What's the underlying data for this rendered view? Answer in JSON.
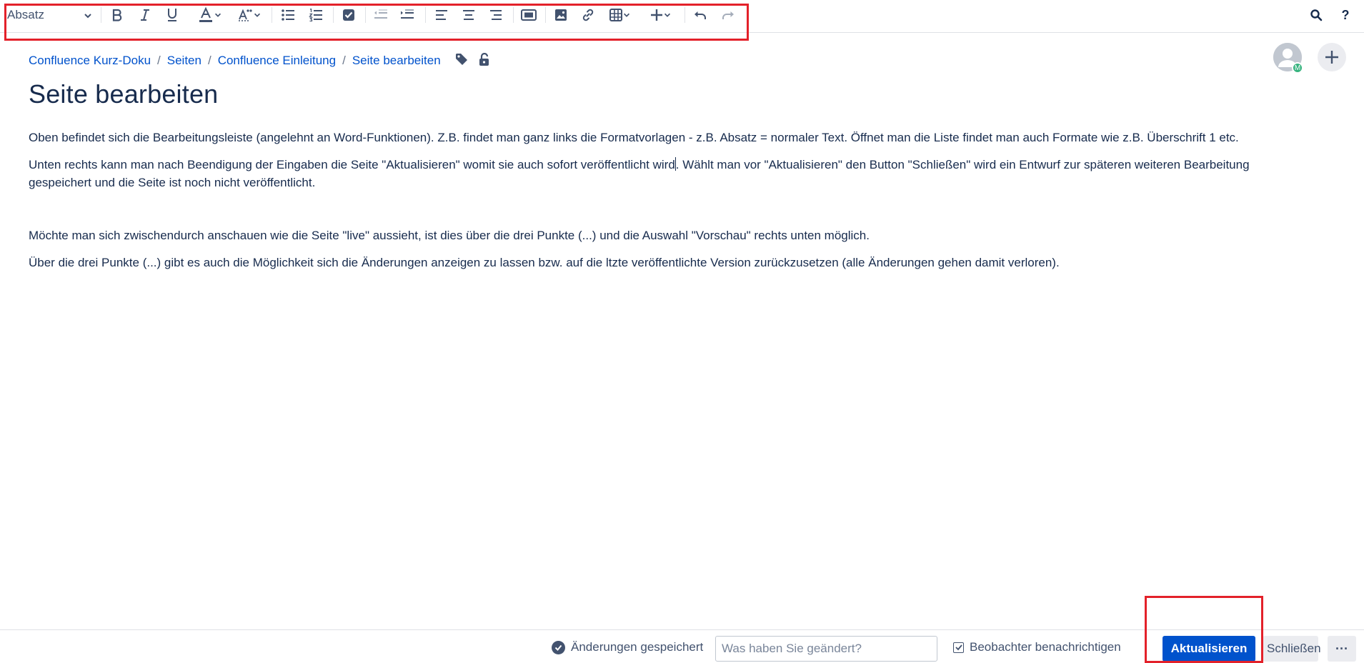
{
  "toolbar": {
    "paragraph_style": "Absatz"
  },
  "breadcrumb": [
    {
      "label": "Confluence Kurz-Doku"
    },
    {
      "label": "Seiten"
    },
    {
      "label": "Confluence Einleitung"
    },
    {
      "label": "Seite bearbeiten"
    }
  ],
  "breadcrumb_separator": "/",
  "avatar": {
    "badge": "M"
  },
  "page": {
    "title": "Seite bearbeiten",
    "paragraphs": [
      "Oben befindet sich die Bearbeitungsleiste (angelehnt an Word-Funktionen). Z.B. findet man ganz links die Formatvorlagen - z.B. Absatz = normaler Text. Öffnet man die Liste findet man auch Formate wie z.B. Überschrift 1 etc.",
      "Unten rechts kann man nach Beendigung der Eingaben die Seite \"Aktualisieren\" womit sie auch sofort veröffentlicht wird",
      ". Wählt man vor \"Aktualisieren\" den Button \"Schließen\" wird ein Entwurf zur späteren weiteren Bearbeitung gespeichert und die Seite ist noch nicht veröffentlicht.",
      "Möchte man sich zwischendurch anschauen wie die Seite \"live\" aussieht, ist dies über die drei Punkte (...) und die Auswahl \"Vorschau\" rechts unten möglich.",
      "Über die drei Punkte (...) gibt es auch die Möglichkeit sich die Änderungen anzeigen zu lassen bzw. auf die ltzte veröffentlichte Version zurückzusetzen (alle Änderungen gehen damit verloren)."
    ]
  },
  "footer": {
    "saved_status": "Änderungen gespeichert",
    "change_placeholder": "Was haben Sie geändert?",
    "notify_label": "Beobachter benachrichtigen",
    "update_label": "Aktualisieren",
    "close_label": "Schließen",
    "more_label": "···"
  },
  "colors": {
    "primary": "#0052cc",
    "link": "#0052cc",
    "highlight": "#e3212a",
    "text": "#172b4d",
    "presence": "#36b37e"
  }
}
